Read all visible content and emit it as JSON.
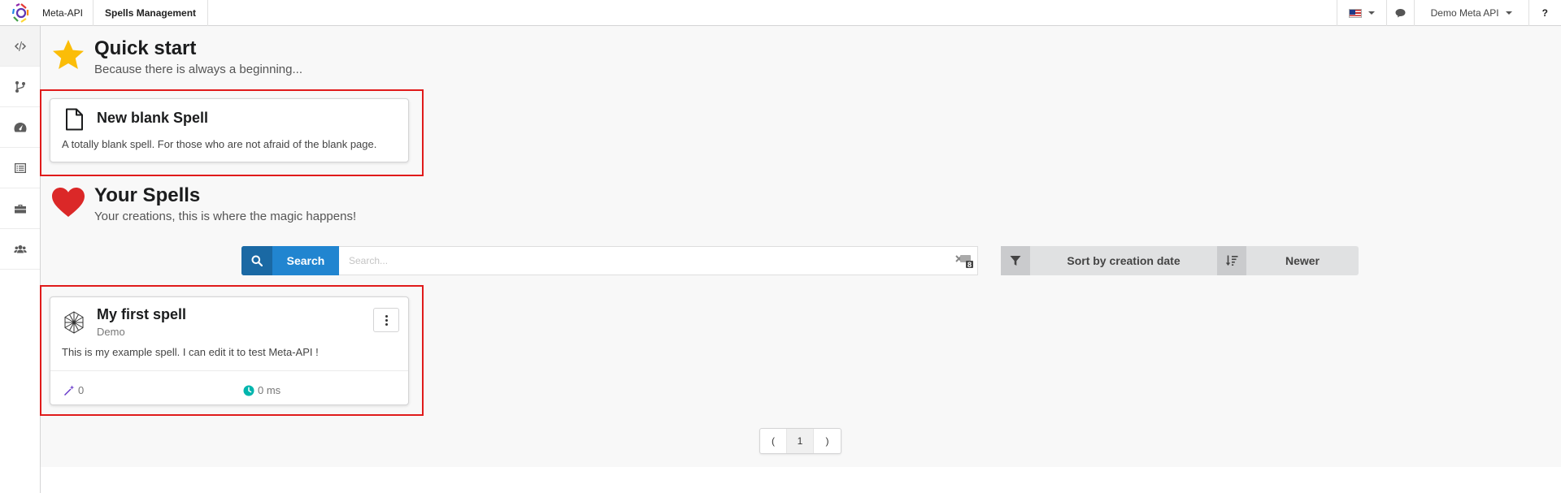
{
  "topbar": {
    "app_name": "Meta-API",
    "nav_item": "Spells Management",
    "user_name": "Demo Meta API",
    "help_label": "?",
    "icons": [
      "meta-api-logo",
      "us-flag-icon",
      "chat-icon",
      "help-icon"
    ]
  },
  "sidebar": {
    "items": [
      {
        "name": "code",
        "icon": "code-icon",
        "active": true
      },
      {
        "name": "branch",
        "icon": "branch-icon"
      },
      {
        "name": "dashboard",
        "icon": "dashboard-icon"
      },
      {
        "name": "list",
        "icon": "list-icon"
      },
      {
        "name": "briefcase",
        "icon": "briefcase-icon"
      },
      {
        "name": "users",
        "icon": "users-icon"
      }
    ]
  },
  "quick_start": {
    "title": "Quick start",
    "subtitle": "Because there is always a beginning...",
    "icon": "star-icon",
    "card": {
      "title": "New blank Spell",
      "description": "A totally blank spell. For those who are not afraid of the blank page.",
      "icon": "file-icon"
    }
  },
  "your_spells": {
    "title": "Your Spells",
    "subtitle": "Your creations, this is where the magic happens!",
    "icon": "heart-icon"
  },
  "search": {
    "button_label": "Search",
    "placeholder": "Search...",
    "value": "",
    "badge": "8"
  },
  "sort": {
    "field_label": "Sort by creation date",
    "order_label": "Newer"
  },
  "spells": [
    {
      "title": "My first spell",
      "owner": "Demo",
      "description": "This is my example spell. I can edit it to test Meta-API !",
      "calls": "0",
      "duration": "0 ms"
    }
  ],
  "pagination": {
    "prev": "(",
    "current": "1",
    "next": ")"
  },
  "colors": {
    "primary": "#2185d0",
    "highlight": "#e01b1b",
    "star": "#fbbd08",
    "heart": "#db2828",
    "wand": "#6435c9",
    "clock": "#00b5ad"
  }
}
